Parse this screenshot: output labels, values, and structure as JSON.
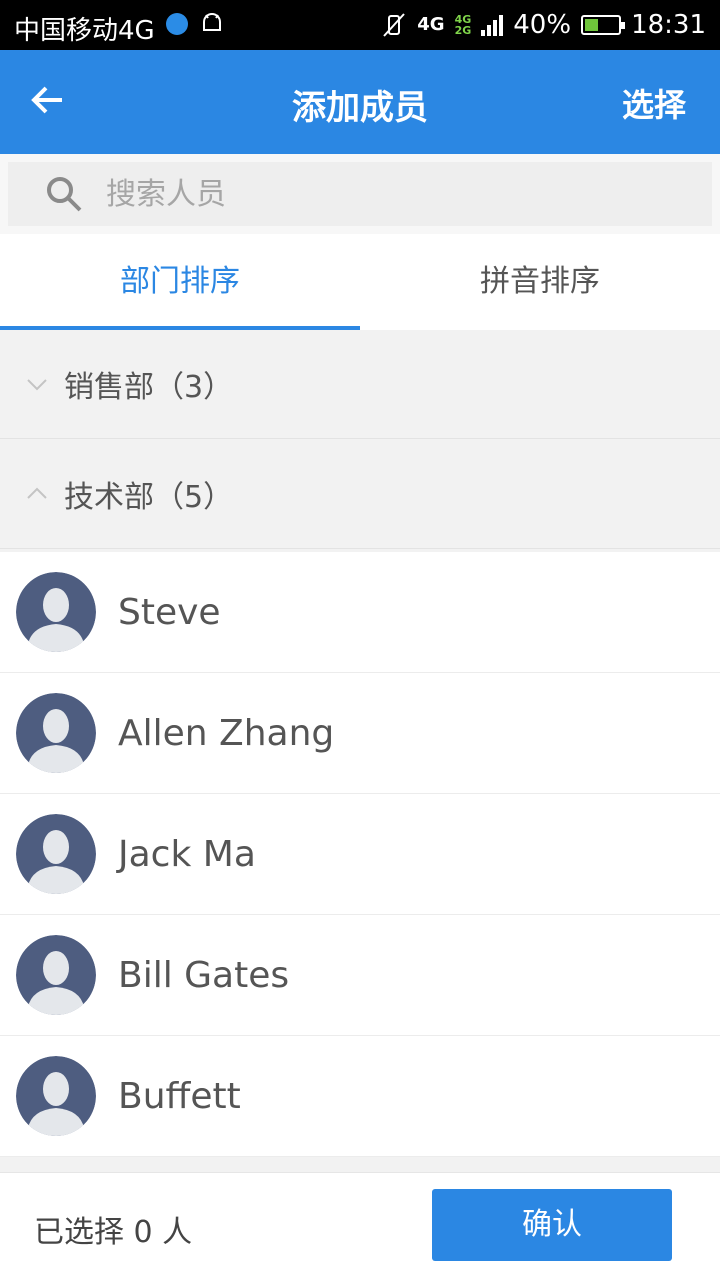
{
  "status_bar": {
    "carrier": "中国移动4G",
    "network": "4G",
    "network_small_top": "4G",
    "network_small_bottom": "2G",
    "battery": "40%",
    "battery_level": 0.4,
    "time": "18:31"
  },
  "header": {
    "title": "添加成员",
    "action": "选择"
  },
  "search": {
    "placeholder": "搜索人员"
  },
  "tabs": [
    {
      "label": "部门排序",
      "active": true
    },
    {
      "label": "拼音排序",
      "active": false
    }
  ],
  "groups": [
    {
      "label": "销售部（3）",
      "expanded": false
    },
    {
      "label": "技术部（5）",
      "expanded": true
    }
  ],
  "members": [
    {
      "name": "Steve"
    },
    {
      "name": "Allen Zhang"
    },
    {
      "name": "Jack Ma"
    },
    {
      "name": "Bill Gates"
    },
    {
      "name": "Buffett"
    }
  ],
  "footer": {
    "selected": "已选择 0 人",
    "confirm": "确认"
  },
  "colors": {
    "primary": "#2b87e3",
    "avatar_bg": "#4e5d80"
  }
}
